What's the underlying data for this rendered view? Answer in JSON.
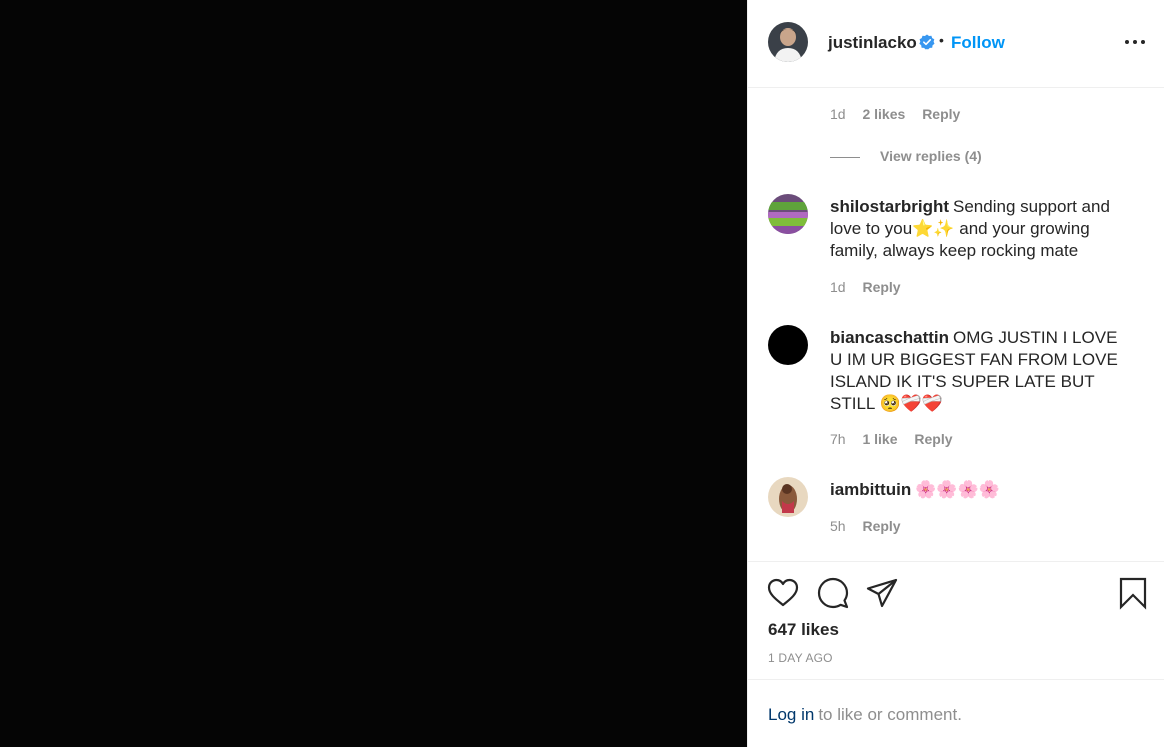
{
  "header": {
    "username": "justinlacko",
    "separator": "•",
    "follow_label": "Follow"
  },
  "comments": [
    {
      "time": "1d",
      "likes": "2 likes",
      "reply_label": "Reply"
    },
    {
      "view_replies": "View replies (4)"
    },
    {
      "username": "shilostarbright",
      "text": "Sending support and love to you⭐✨ and your growing family, always keep rocking mate",
      "time": "1d",
      "reply_label": "Reply"
    },
    {
      "username": "biancaschattin",
      "text": "OMG JUSTIN I LOVE U IM UR BIGGEST FAN FROM LOVE ISLAND IK IT'S SUPER LATE BUT STILL 🥺❤️‍🩹❤️‍🩹",
      "time": "7h",
      "likes": "1 like",
      "reply_label": "Reply"
    },
    {
      "username": "iambittuin",
      "text": "🌸🌸🌸🌸",
      "time": "5h",
      "reply_label": "Reply"
    }
  ],
  "post": {
    "likes": "647 likes",
    "time": "1 DAY AGO"
  },
  "login": {
    "link": "Log in",
    "rest": "to like or comment."
  },
  "colors": {
    "accent": "#0095f6",
    "muted": "#8e8e8e",
    "text": "#262626",
    "link": "#00376b"
  }
}
